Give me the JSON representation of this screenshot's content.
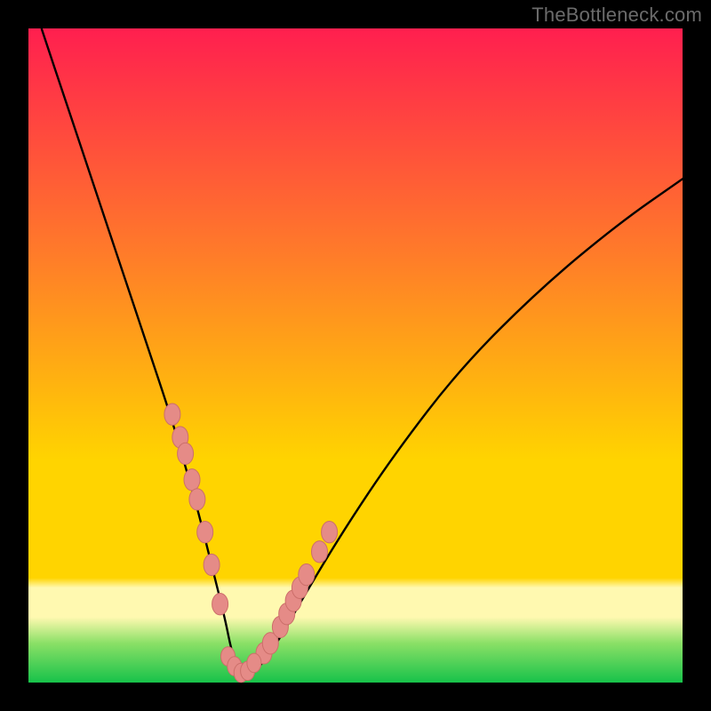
{
  "watermark": "TheBottleneck.com",
  "colors": {
    "frame": "#000000",
    "grad_top": "#ff1f4f",
    "grad_mid1": "#ff7a2a",
    "grad_mid2": "#ffd400",
    "grad_pale": "#fff9b0",
    "grad_green1": "#8ae066",
    "grad_green2": "#17c24a",
    "line": "#000000",
    "marker_fill": "#e58b87",
    "marker_stroke": "#cc6f6a"
  },
  "chart_data": {
    "type": "line",
    "title": "",
    "xlabel": "",
    "ylabel": "",
    "ylim": [
      0,
      100
    ],
    "xlim": [
      0,
      100
    ],
    "series": [
      {
        "name": "bottleneck-curve",
        "x": [
          2,
          6,
          10,
          14,
          18,
          22,
          24,
          26,
          28,
          30,
          31,
          32,
          33.5,
          35,
          38,
          42,
          48,
          56,
          66,
          78,
          90,
          100
        ],
        "y": [
          100,
          88,
          76,
          64,
          52,
          40,
          33,
          26,
          18,
          10,
          5,
          2,
          1,
          2,
          6,
          13,
          23,
          35,
          48,
          60,
          70,
          77
        ]
      }
    ],
    "markers": {
      "left_cluster_x": [
        22.0,
        23.2,
        24.0,
        25.0,
        25.8,
        27.0,
        28.0,
        29.3
      ],
      "left_cluster_y": [
        41.0,
        37.5,
        35.0,
        31.0,
        28.0,
        23.0,
        18.0,
        12.0
      ],
      "bottom_cluster_x": [
        30.5,
        31.5,
        32.5,
        33.5,
        34.5
      ],
      "bottom_cluster_y": [
        4.0,
        2.5,
        1.5,
        1.8,
        3.0
      ],
      "right_cluster_x": [
        36.0,
        37.0,
        38.5,
        39.5,
        40.5,
        41.5,
        42.5,
        44.5,
        46.0
      ],
      "right_cluster_y": [
        4.5,
        6.0,
        8.5,
        10.5,
        12.5,
        14.5,
        16.5,
        20.0,
        23.0
      ]
    }
  }
}
